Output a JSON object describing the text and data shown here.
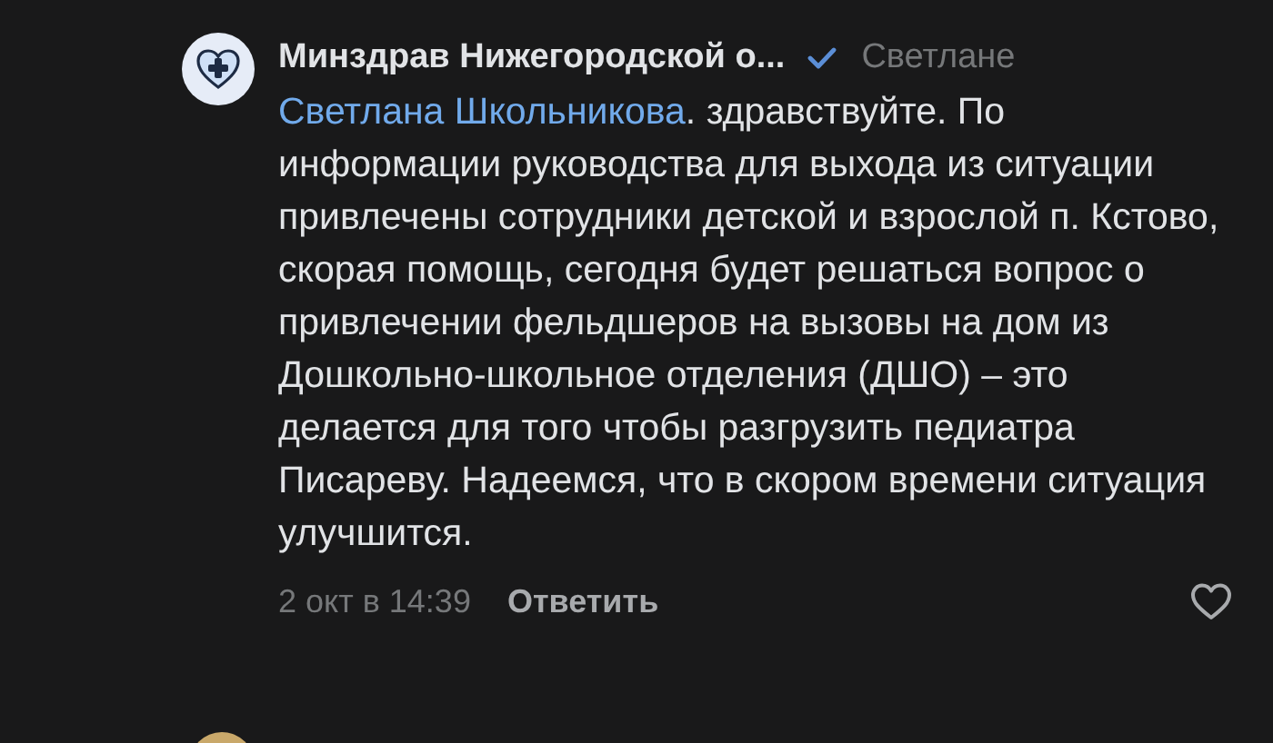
{
  "comment": {
    "author": "Минздрав Нижегородской о...",
    "verified": true,
    "reply_to_label": "Светлане",
    "mention": "Светлана Школьникова",
    "text": ". здравствуйте. По информации руководства для выхода из ситуации привлечены сотрудники детской и взрослой п. Кстово, скорая помощь, сегодня будет решаться вопрос о привлечении фельдшеров на вызовы на дом из Дошкольно-школьное отделения (ДШО) – это делается для того чтобы разгрузить педиатра Писареву. Надеемся, что в скором времени ситуация улучшится.",
    "date": "2 окт в 14:39",
    "reply_button": "Ответить",
    "liked": false
  }
}
